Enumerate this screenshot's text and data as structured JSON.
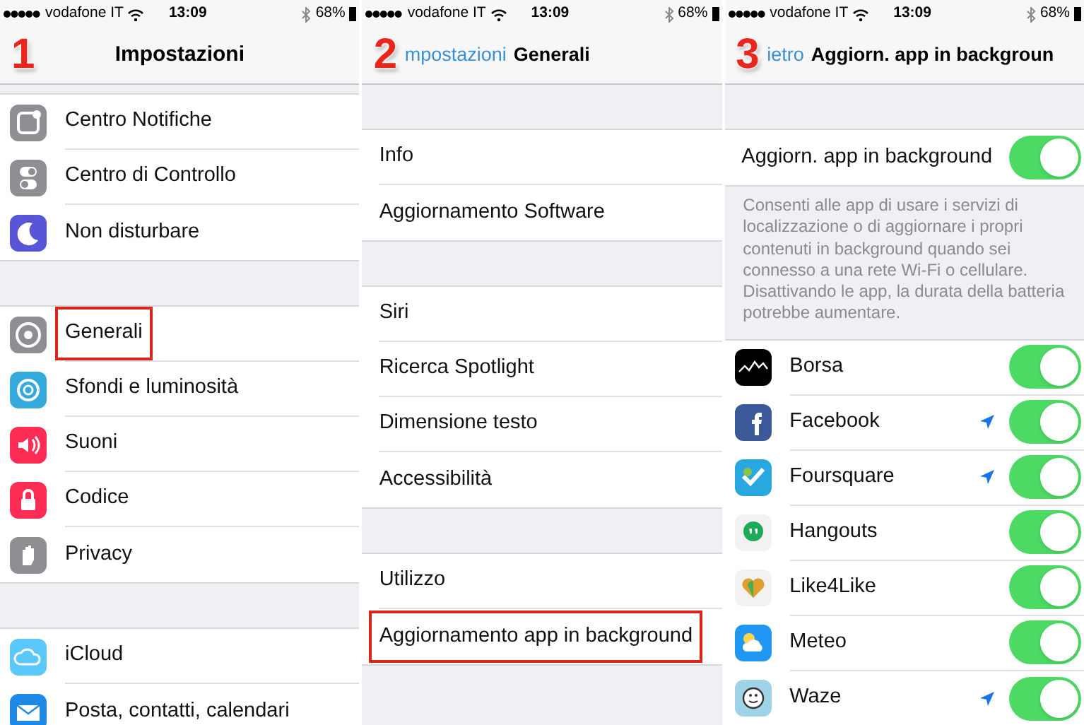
{
  "panels": [
    {
      "status_bar": {
        "carrier": "vodafone IT",
        "time": "13:09",
        "battery": "68%"
      },
      "nav": {
        "step": "1",
        "title": "Impostazioni"
      },
      "sections": [
        {
          "rows": [
            {
              "kind": "icon",
              "label": "Centro Notifiche",
              "highlighted": false
            },
            {
              "kind": "icon",
              "label": "Centro di Controllo",
              "highlighted": false
            },
            {
              "kind": "icon",
              "label": "Non disturbare",
              "highlighted": false
            }
          ]
        },
        {
          "rows": [
            {
              "kind": "icon",
              "label": "Generali",
              "highlighted": true
            },
            {
              "kind": "icon",
              "label": "Sfondi e luminosità",
              "highlighted": false
            },
            {
              "kind": "icon",
              "label": "Suoni",
              "highlighted": false
            },
            {
              "kind": "icon",
              "label": "Codice",
              "highlighted": false
            },
            {
              "kind": "icon",
              "label": "Privacy",
              "highlighted": false
            }
          ]
        },
        {
          "rows": [
            {
              "kind": "icon",
              "label": "iCloud",
              "highlighted": false
            },
            {
              "kind": "icon",
              "label": "Posta, contatti, calendari",
              "highlighted": false
            }
          ]
        }
      ]
    },
    {
      "status_bar": {
        "carrier": "vodafone IT",
        "time": "13:09",
        "battery": "68%"
      },
      "nav": {
        "step": "2",
        "back": "mpostazioni",
        "title": "Generali"
      },
      "sections": [
        {
          "rows": [
            {
              "kind": "plain",
              "label": "Info",
              "highlighted": false
            },
            {
              "kind": "plain",
              "label": "Aggiornamento Software",
              "highlighted": false
            }
          ]
        },
        {
          "rows": [
            {
              "kind": "plain",
              "label": "Siri",
              "highlighted": false
            },
            {
              "kind": "plain",
              "label": "Ricerca Spotlight",
              "highlighted": false
            },
            {
              "kind": "plain",
              "label": "Dimensione testo",
              "highlighted": false
            },
            {
              "kind": "plain",
              "label": "Accessibilità",
              "highlighted": false
            }
          ]
        },
        {
          "rows": [
            {
              "kind": "plain",
              "label": "Utilizzo",
              "highlighted": false
            },
            {
              "kind": "plain",
              "label": "Aggiornamento app in background",
              "highlighted": true
            }
          ]
        }
      ]
    },
    {
      "status_bar": {
        "carrier": "vodafone IT",
        "time": "13:09",
        "battery": "68%"
      },
      "nav": {
        "step": "3",
        "back": "ietro",
        "title": "Aggiorn. app in backgroun"
      },
      "sections": [
        {
          "rows": [
            {
              "kind": "toggle",
              "label": "Aggiorn. app in background",
              "on": true
            }
          ],
          "footer": "Consenti alle app di usare i servizi di localizzazione o di aggiornare i propri contenuti in background quando sei connesso a una rete Wi-Fi o cellulare. Disattivando le app, la durata della batteria potrebbe aumentare."
        },
        {
          "rows": [
            {
              "kind": "app",
              "label": "Borsa",
              "location": false,
              "on": true
            },
            {
              "kind": "app",
              "label": "Facebook",
              "location": true,
              "on": true
            },
            {
              "kind": "app",
              "label": "Foursquare",
              "location": true,
              "on": true
            },
            {
              "kind": "app",
              "label": "Hangouts",
              "location": false,
              "on": true
            },
            {
              "kind": "app",
              "label": "Like4Like",
              "location": false,
              "on": true
            },
            {
              "kind": "app",
              "label": "Meteo",
              "location": false,
              "on": true
            },
            {
              "kind": "app",
              "label": "Waze",
              "location": true,
              "on": true
            }
          ]
        }
      ]
    }
  ]
}
